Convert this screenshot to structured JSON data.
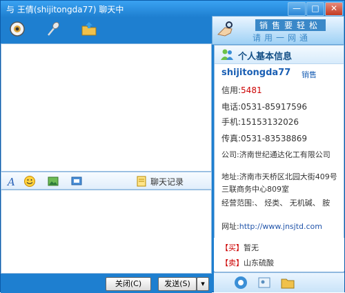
{
  "window": {
    "title": "与 王倩(shijitongda77) 聊天中",
    "min_label": "—",
    "max_label": "□",
    "close_label": "✕"
  },
  "toolbar": {
    "icons": [
      "video-chat-icon",
      "voice-chat-icon",
      "file-transfer-icon"
    ]
  },
  "banner": {
    "line1": "销售要轻松",
    "line2": "请用一网通"
  },
  "edit_toolbar": {
    "icons": [
      "font-icon",
      "emoticon-icon",
      "image-icon",
      "screenshot-icon",
      "history-icon"
    ],
    "history_label": "聊天记录"
  },
  "buttons": {
    "close": "关闭(C)",
    "send": "发送(S)",
    "send_dropdown": "▾"
  },
  "profile": {
    "header": "个人基本信息",
    "username": "shijitongda77",
    "role": "销售",
    "credit_label": "信用:",
    "credit_value": "5481",
    "phone_label": "电话:",
    "phone_value": "0531-85917596",
    "mobile_label": "手机:",
    "mobile_value": "15153132026",
    "fax_label": "传真:",
    "fax_value": "0531-83538869",
    "company_label": "公司:",
    "company_value": "济南世纪通达化工有限公司",
    "address_label": "地址:",
    "address_value": "济南市天桥区北园大街409号三联商务中心809室",
    "scope_label": "经营范围:",
    "scope_value": "、 烃类、 无机碱、 胺",
    "website_label": "网址:",
    "website_value": "http://www.jnsjtd.com"
  },
  "trade": {
    "buy_tag": "【买】",
    "buy_value": "暂无",
    "sell_tag": "【卖】",
    "sell_value": "山东硫酸"
  },
  "panel_tabs": [
    "profile-tab-icon",
    "contacts-tab-icon",
    "folder-tab-icon"
  ]
}
